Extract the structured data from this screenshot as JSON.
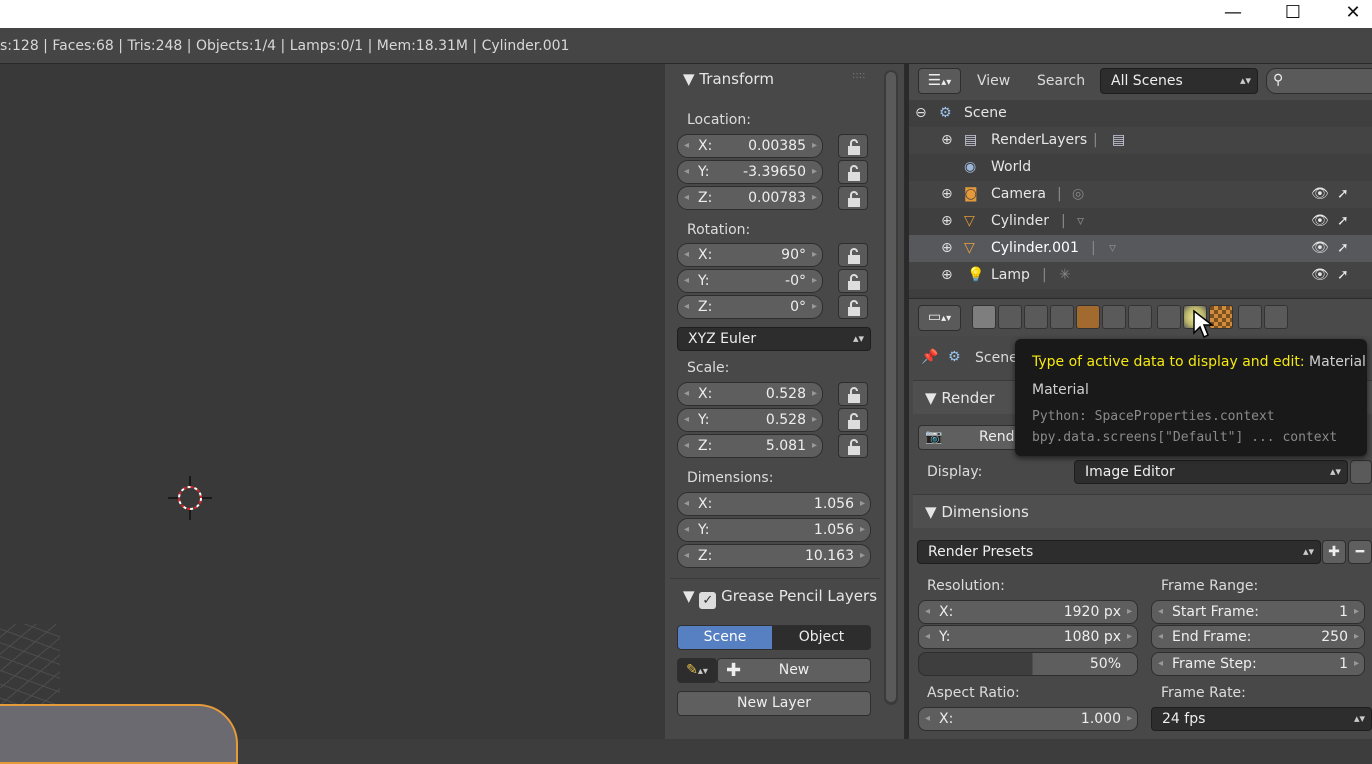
{
  "window": {
    "minimize": "—",
    "maximize": "☐",
    "close": "✕"
  },
  "infobar": {
    "text": "s:128 | Faces:68 | Tris:248 | Objects:1/4 | Lamps:0/1 | Mem:18.31M | Cylinder.001"
  },
  "transform": {
    "title": "Transform",
    "location_label": "Location:",
    "location": [
      {
        "axis": "X:",
        "value": "0.00385"
      },
      {
        "axis": "Y:",
        "value": "-3.39650"
      },
      {
        "axis": "Z:",
        "value": "0.00783"
      }
    ],
    "rotation_label": "Rotation:",
    "rotation": [
      {
        "axis": "X:",
        "value": "90°"
      },
      {
        "axis": "Y:",
        "value": "-0°"
      },
      {
        "axis": "Z:",
        "value": "0°"
      }
    ],
    "rotation_mode": "XYZ Euler",
    "scale_label": "Scale:",
    "scale": [
      {
        "axis": "X:",
        "value": "0.528"
      },
      {
        "axis": "Y:",
        "value": "0.528"
      },
      {
        "axis": "Z:",
        "value": "5.081"
      }
    ],
    "dimensions_label": "Dimensions:",
    "dimensions": [
      {
        "axis": "X:",
        "value": "1.056"
      },
      {
        "axis": "Y:",
        "value": "1.056"
      },
      {
        "axis": "Z:",
        "value": "10.163"
      }
    ]
  },
  "grease_pencil": {
    "title": "Grease Pencil Layers",
    "scene_tab": "Scene",
    "object_tab": "Object",
    "new_button": "New",
    "new_layer_button": "New Layer"
  },
  "outliner": {
    "view_menu": "View",
    "search_menu": "Search",
    "display_mode": "All Scenes",
    "rows": [
      {
        "label": "Scene"
      },
      {
        "label": "RenderLayers"
      },
      {
        "label": "World"
      },
      {
        "label": "Camera"
      },
      {
        "label": "Cylinder"
      },
      {
        "label": "Cylinder.001"
      },
      {
        "label": "Lamp"
      }
    ]
  },
  "properties": {
    "context_label": "Scene",
    "render_section": "Render",
    "render_button": "Rend",
    "display_label": "Display:",
    "display_value": "Image Editor",
    "dimensions_section": "Dimensions",
    "render_presets": "Render Presets",
    "resolution_label": "Resolution:",
    "res_x_axis": "X:",
    "res_x": "1920 px",
    "res_y_axis": "Y:",
    "res_y": "1080 px",
    "res_pct": "50%",
    "frame_range_label": "Frame Range:",
    "start_frame_label": "Start Frame:",
    "start_frame": "1",
    "end_frame_label": "End Frame:",
    "end_frame": "250",
    "frame_step_label": "Frame Step:",
    "frame_step": "1",
    "aspect_label": "Aspect Ratio:",
    "aspect_x_axis": "X:",
    "aspect_x": "1.000",
    "frame_rate_label": "Frame Rate:",
    "frame_rate": "24 fps"
  },
  "tooltip": {
    "title": "Type of active data to display and edit:",
    "value": "Material",
    "subtitle": "Material",
    "python1": "Python: SpaceProperties.context",
    "python2": "bpy.data.screens[\"Default\"] ... context",
    "title_color": "#f5e90f"
  }
}
